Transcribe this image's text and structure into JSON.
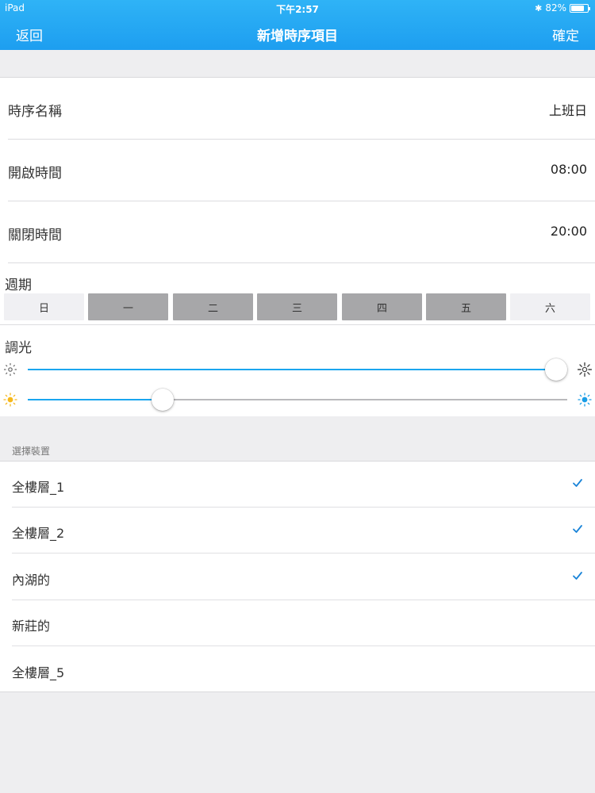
{
  "status_bar": {
    "carrier": "iPad",
    "time": "下午2:57",
    "battery": "82%",
    "battery_level": 0.82,
    "bluetooth_icon": "bluetooth-icon"
  },
  "nav": {
    "back_label": "返回",
    "title": "新增時序項目",
    "confirm_label": "確定"
  },
  "form": {
    "rows": [
      {
        "label": "時序名稱",
        "value": "上班日"
      },
      {
        "label": "開啟時間",
        "value": "08:00"
      },
      {
        "label": "關閉時間",
        "value": "20:00"
      }
    ],
    "week_label": "週期",
    "days": [
      {
        "label": "日",
        "selected": false
      },
      {
        "label": "一",
        "selected": true
      },
      {
        "label": "二",
        "selected": true
      },
      {
        "label": "三",
        "selected": true
      },
      {
        "label": "四",
        "selected": true
      },
      {
        "label": "五",
        "selected": true
      },
      {
        "label": "六",
        "selected": false
      }
    ],
    "dimming_label": "調光",
    "sliders": [
      {
        "name": "brightness",
        "value": 0.98,
        "left_icon": "brightness-low-icon",
        "right_icon": "brightness-high-icon"
      },
      {
        "name": "color-temperature",
        "value": 0.25,
        "left_icon": "warm-sun-icon",
        "right_icon": "cool-sun-icon"
      }
    ]
  },
  "devices": {
    "header": "選擇裝置",
    "items": [
      {
        "name": "全樓層_1",
        "checked": true
      },
      {
        "name": "全樓層_2",
        "checked": true
      },
      {
        "name": "內湖的",
        "checked": true
      },
      {
        "name": "新莊的",
        "checked": false
      },
      {
        "name": "全樓層_5",
        "checked": false
      }
    ]
  },
  "colors": {
    "accent": "#1aa6ef",
    "nav_bar": "#1d9ef0",
    "day_selected": "#a7a7a9",
    "day_unselected": "#f0f0f3",
    "warm_icon": "#f6b81c",
    "cool_icon": "#1a9de6",
    "check": "#1a84d8"
  }
}
